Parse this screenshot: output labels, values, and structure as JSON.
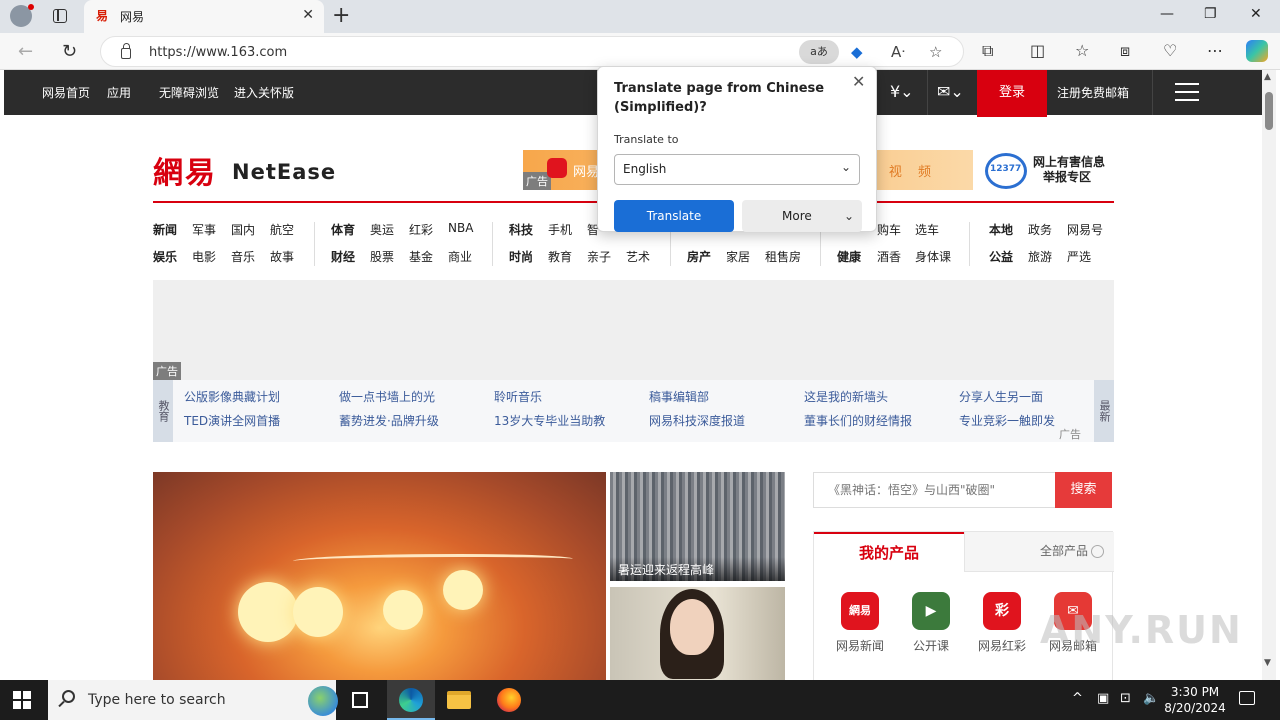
{
  "browser": {
    "tab_title": "网易",
    "url": "https://www.163.com",
    "translate_chip": "aあ"
  },
  "site": {
    "topnav": [
      "网易首页",
      "应用",
      "无障碍浏览",
      "进入关怀版"
    ],
    "login": "登录",
    "register": "注册免费邮箱",
    "logo_cn": "網易",
    "logo_en": "NetEase",
    "ad_label": "广告",
    "ad_banner_brand": "网易",
    "ad_banner_text": "讯 视 频",
    "report_text_line1": "网上有害信息",
    "report_text_line2": "举报专区",
    "report_logo": "12377",
    "categories": [
      [
        "新闻",
        "军事",
        "国内",
        "航空",
        "体育",
        "奥运",
        "红彩",
        "NBA",
        "科技",
        "手机",
        "智",
        "购车",
        "选车",
        "本地",
        "政务",
        "网易号"
      ],
      [
        "娱乐",
        "电影",
        "音乐",
        "故事",
        "财经",
        "股票",
        "基金",
        "商业",
        "时尚",
        "教育",
        "亲子",
        "艺术",
        "房产",
        "家居",
        "租售房",
        "健康",
        "酒香",
        "身体课",
        "公益",
        "旅游",
        "严选"
      ]
    ],
    "promo_left": "教育",
    "promo_right": "最新",
    "promo_links": [
      [
        "公版影像典藏计划",
        "TED演讲全网首播"
      ],
      [
        "做一点书墙上的光",
        "蓄势进发·品牌升级"
      ],
      [
        "聆听音乐",
        "13岁大专毕业当助教"
      ],
      [
        "稿事编辑部",
        "网易科技深度报道"
      ],
      [
        "这是我的新墙头",
        "董事长们的财经情报"
      ],
      [
        "分享人生另一面",
        "专业竞彩一触即发"
      ]
    ],
    "thumb1_caption": "暑运迎来返程高峰",
    "search_placeholder": "《黑神话：悟空》与山西\"破圈\"",
    "search_button": "搜索",
    "products_tab": "我的产品",
    "all_products_tab": "全部产品",
    "products": [
      {
        "label": "网易新闻",
        "icon": "網易",
        "color": "#e0141e"
      },
      {
        "label": "公开课",
        "icon": "▶",
        "color": "#2e8b57"
      },
      {
        "label": "网易红彩",
        "icon": "彩",
        "color": "#e0141e"
      },
      {
        "label": "网易邮箱",
        "icon": "✉",
        "color": "#e53935"
      }
    ]
  },
  "translate_popup": {
    "title": "Translate page from Chinese (Simplified)?",
    "translate_to_label": "Translate to",
    "language": "English",
    "translate_button": "Translate",
    "more_button": "More"
  },
  "taskbar": {
    "search_placeholder": "Type here to search",
    "time": "3:30 PM",
    "date": "8/20/2024"
  },
  "watermark": "ANY.RUN"
}
